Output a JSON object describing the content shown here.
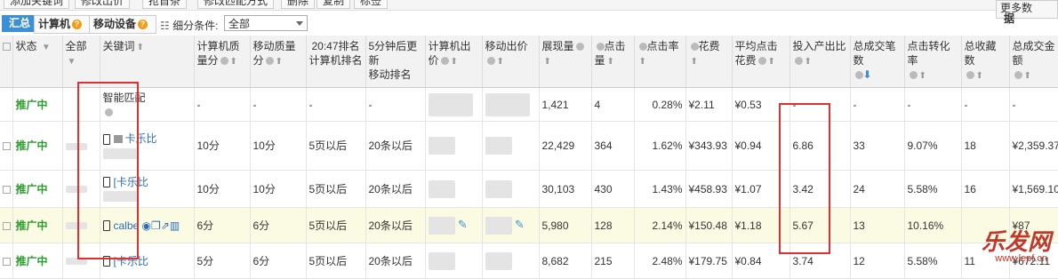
{
  "toolbar": {
    "buttons": [
      "添加关键词",
      "修改出价",
      "抢首条",
      "修改匹配方式",
      "删除",
      "复制",
      "标签"
    ],
    "more_label": "更多数",
    "more_sub": "据"
  },
  "filter": {
    "tabs": [
      {
        "label": "汇总"
      },
      {
        "label": "计算机"
      },
      {
        "label": "移动设备"
      }
    ],
    "condition_label": "细分条件:",
    "condition_value": "全部"
  },
  "table": {
    "headers": [
      "",
      "状态",
      "全部",
      "关键词",
      "计算机质量分",
      "移动质量分",
      "20:47排名",
      "5分钟后更新",
      "计算机出价",
      "移动出价",
      "展现量",
      "点击量",
      "点击率",
      "花费",
      "平均点击花费",
      "投入产出比",
      "总成交笔数",
      "点击转化率",
      "总收藏数",
      "总成交金额"
    ],
    "header_subs": {
      "rank_col": "计算机排名",
      "update_col": "移动排名"
    },
    "rows": [
      {
        "status": "推广中",
        "keyword": "智能匹配",
        "pc_q": "-",
        "mob_q": "-",
        "rank": "-",
        "upd": "-",
        "imp": "1,421",
        "clk": "4",
        "ctr": "0.28%",
        "cost": "¥2.11",
        "cpc": "¥0.53",
        "roi": "-",
        "deals": "-",
        "cvr": "-",
        "fav": "-",
        "amount": "-"
      },
      {
        "status": "推广中",
        "keyword": "卡乐比",
        "pc_q": "10分",
        "mob_q": "10分",
        "rank": "5页以后",
        "upd": "20条以后",
        "imp": "22,429",
        "clk": "364",
        "ctr": "1.62%",
        "cost": "¥343.93",
        "cpc": "¥0.94",
        "roi": "6.86",
        "deals": "33",
        "cvr": "9.07%",
        "fav": "18",
        "amount": "¥2,359.37"
      },
      {
        "status": "推广中",
        "keyword": "[卡乐比",
        "pc_q": "10分",
        "mob_q": "10分",
        "rank": "5页以后",
        "upd": "20条以后",
        "imp": "30,103",
        "clk": "430",
        "ctr": "1.43%",
        "cost": "¥458.93",
        "cpc": "¥1.07",
        "roi": "3.42",
        "deals": "24",
        "cvr": "5.58%",
        "fav": "16",
        "amount": "¥1,569.10"
      },
      {
        "status": "推广中",
        "keyword": "calbe",
        "pc_q": "6分",
        "mob_q": "6分",
        "rank": "5页以后",
        "upd": "20条以后",
        "imp": "5,980",
        "clk": "128",
        "ctr": "2.14%",
        "cost": "¥150.48",
        "cpc": "¥1.18",
        "roi": "5.67",
        "deals": "13",
        "cvr": "10.16%",
        "fav": "",
        "amount": "¥87"
      },
      {
        "status": "推广中",
        "keyword": "[卡乐比",
        "pc_q": "5分",
        "mob_q": "6分",
        "rank": "5页以后",
        "upd": "20条以后",
        "imp": "8,682",
        "clk": "215",
        "ctr": "2.48%",
        "cost": "¥179.75",
        "cpc": "¥0.84",
        "roi": "3.74",
        "deals": "12",
        "cvr": "5.58%",
        "fav": "11",
        "amount": "¥672.11"
      }
    ]
  },
  "watermark": {
    "title": "乐发网",
    "url": "www.lepf.cn"
  },
  "colors": {
    "status_green": "#2a9e2a",
    "accent_blue": "#3b8fd6",
    "highlight_red": "#e03030"
  }
}
